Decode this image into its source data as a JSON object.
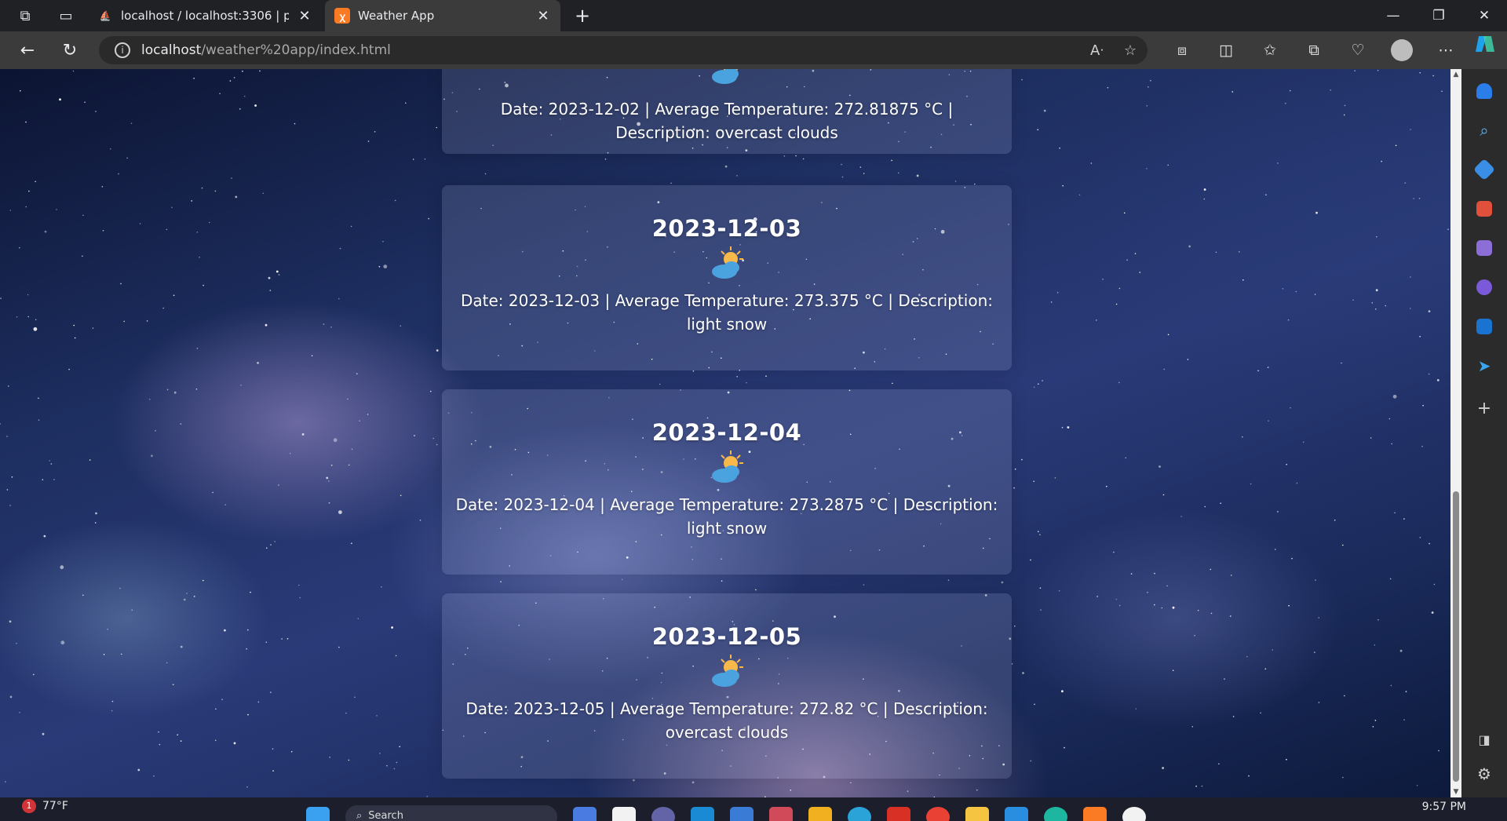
{
  "browser": {
    "tabs": [
      {
        "title": "localhost / localhost:3306 | phpM",
        "active": false
      },
      {
        "title": "Weather App",
        "active": true
      }
    ],
    "url_host": "localhost",
    "url_path": "/weather%20app/index.html"
  },
  "forecast": [
    {
      "date": "",
      "description_line": "Date: 2023-12-02 | Average Temperature: 272.81875 °C | Description: overcast clouds",
      "icon": "partly-cloudy-icon"
    },
    {
      "date": "2023-12-03",
      "description_line": "Date: 2023-12-03 | Average Temperature: 273.375 °C | Description: light snow",
      "icon": "partly-cloudy-icon"
    },
    {
      "date": "2023-12-04",
      "description_line": "Date: 2023-12-04 | Average Temperature: 273.2875 °C | Description: light snow",
      "icon": "partly-cloudy-icon"
    },
    {
      "date": "2023-12-05",
      "description_line": "Date: 2023-12-05 | Average Temperature: 272.82 °C | Description: overcast clouds",
      "icon": "partly-cloudy-icon"
    }
  ],
  "taskbar": {
    "weather_temp": "77°F",
    "notification_count": "1",
    "search_placeholder": "Search",
    "clock": "9:57 PM"
  },
  "colors": {
    "sun": "#f8b84a",
    "cloud": "#4aa3df",
    "edge_accent": "#2b7de9"
  }
}
